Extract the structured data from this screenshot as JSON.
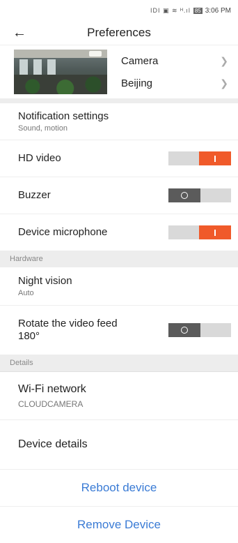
{
  "status_bar": {
    "time": "3:06 PM",
    "battery": "85",
    "icons": "IDI ▣ ≋ ᴴ.ıl"
  },
  "header": {
    "title": "Preferences",
    "back_icon": "arrow-left-icon"
  },
  "camera": {
    "name": "Camera",
    "location": "Beijing"
  },
  "settings": {
    "notification": {
      "label": "Notification settings",
      "sub": "Sound, motion"
    },
    "hd_video": {
      "label": "HD video",
      "on": true
    },
    "buzzer": {
      "label": "Buzzer",
      "on": false
    },
    "microphone": {
      "label": "Device microphone",
      "on": true
    }
  },
  "hardware": {
    "header": "Hardware",
    "night_vision": {
      "label": "Night vision",
      "sub": "Auto"
    },
    "rotate": {
      "label_line1": "Rotate the video feed",
      "label_line2": "180°",
      "on": false
    }
  },
  "details": {
    "header": "Details",
    "wifi": {
      "label": "Wi-Fi network",
      "sub": "CLOUDCAMERA"
    },
    "device_details": {
      "label": "Device details"
    }
  },
  "actions": {
    "reboot": "Reboot device",
    "remove": "Remove Device"
  },
  "colors": {
    "toggle_on": "#f05a2a",
    "toggle_off": "#5b5b5b",
    "link": "#3a7bd5"
  }
}
